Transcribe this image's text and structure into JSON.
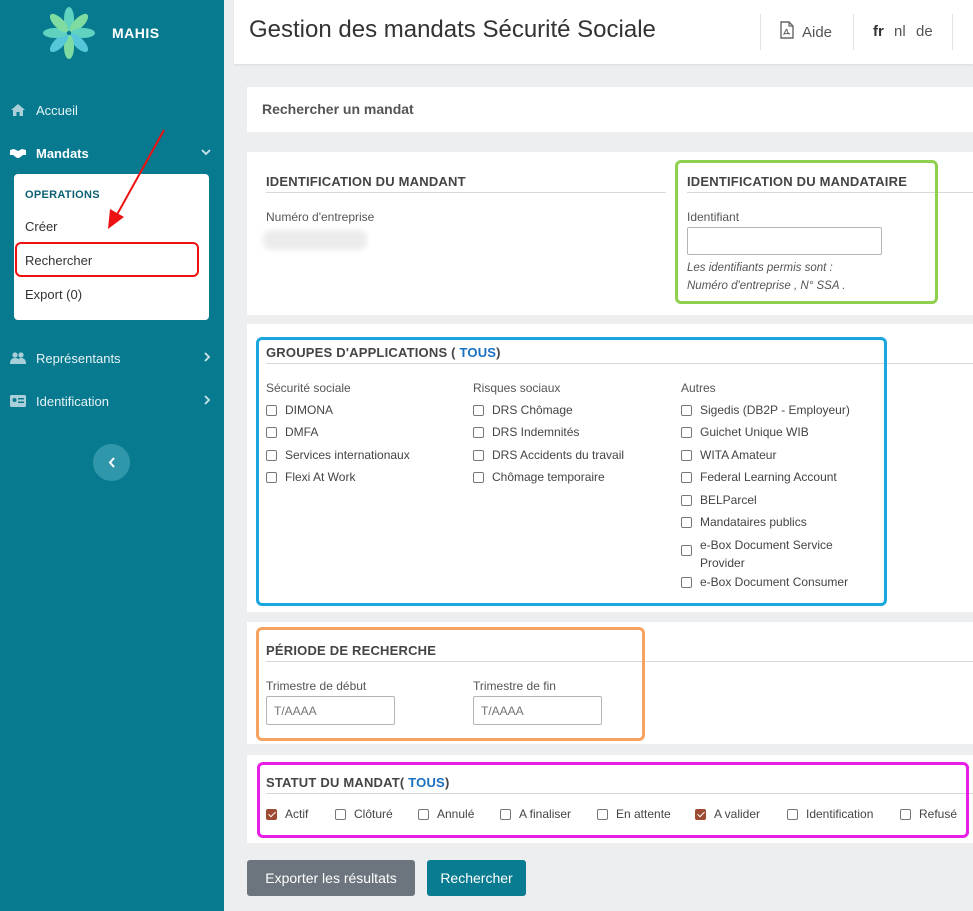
{
  "app": {
    "brand": "MAHIS"
  },
  "sidebar": {
    "items": [
      {
        "label": "Accueil"
      },
      {
        "label": "Mandats"
      },
      {
        "label": "Représentants"
      },
      {
        "label": "Identification"
      }
    ],
    "submenu": {
      "category": "OPERATIONS",
      "items": [
        {
          "label": "Créer"
        },
        {
          "label": "Rechercher"
        },
        {
          "label": "Export (0)"
        }
      ]
    }
  },
  "header": {
    "title": "Gestion des mandats Sécurité Sociale",
    "help": "Aide",
    "languages": [
      "fr",
      "nl",
      "de"
    ]
  },
  "search_bar": {
    "title": "Rechercher un mandat"
  },
  "mandant": {
    "title": "IDENTIFICATION DU MANDANT",
    "field_label": "Numéro d'entreprise"
  },
  "mandataire": {
    "title": "IDENTIFICATION DU MANDATAIRE",
    "field_label": "Identifiant",
    "value": "",
    "hint1": "Les identifiants permis sont :",
    "hint2": "Numéro d'entreprise , N° SSA ."
  },
  "groups": {
    "title": "GROUPES D'APPLICATIONS ( ",
    "all": "TOUS",
    "close": ")",
    "columns": [
      {
        "title": "Sécurité sociale",
        "items": [
          "DIMONA",
          "DMFA",
          "Services internationaux",
          "Flexi At Work"
        ]
      },
      {
        "title": "Risques sociaux",
        "items": [
          "DRS Chômage",
          "DRS Indemnités",
          "DRS Accidents du travail",
          "Chômage temporaire"
        ]
      },
      {
        "title": "Autres",
        "items": [
          "Sigedis (DB2P - Employeur)",
          "Guichet Unique WIB",
          "WITA Amateur",
          "Federal Learning Account",
          "BELParcel",
          "Mandataires publics",
          "e-Box Document Service",
          "Provider",
          "e-Box Document Consumer"
        ]
      }
    ]
  },
  "period": {
    "title": "PÉRIODE DE RECHERCHE",
    "start_label": "Trimestre de début",
    "start_placeholder": "T/AAAA",
    "end_label": "Trimestre de fin",
    "end_placeholder": "T/AAAA"
  },
  "status": {
    "title": "STATUT DU MANDAT( ",
    "all": "TOUS",
    "close": ")",
    "items": [
      {
        "label": "Actif",
        "checked": true
      },
      {
        "label": "Clôturé",
        "checked": false
      },
      {
        "label": "Annulé",
        "checked": false
      },
      {
        "label": "A finaliser",
        "checked": false
      },
      {
        "label": "En attente",
        "checked": false
      },
      {
        "label": "A valider",
        "checked": true
      },
      {
        "label": "Identification",
        "checked": false
      },
      {
        "label": "Refusé",
        "checked": false
      }
    ]
  },
  "actions": {
    "export": "Exporter les résultats",
    "search": "Rechercher"
  },
  "colors": {
    "sidebar": "#087a90",
    "primary_button": "#0a7c91",
    "secondary_button": "#6c757d",
    "link": "#1a6fc0",
    "checked": "#9c4a32"
  }
}
